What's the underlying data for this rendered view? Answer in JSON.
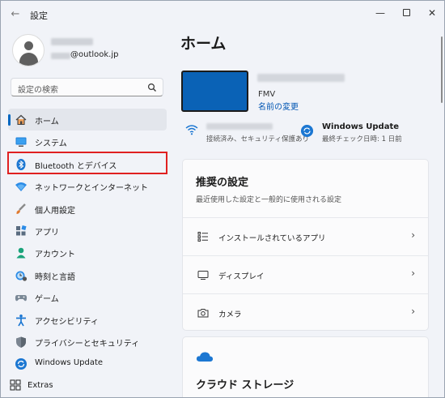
{
  "window": {
    "title": "設定",
    "back_glyph": "←",
    "minimize_glyph": "—",
    "close_glyph": "✕"
  },
  "user": {
    "email_domain": "@outlook.jp"
  },
  "search": {
    "placeholder": "設定の検索"
  },
  "nav": {
    "items": [
      {
        "label": "ホーム",
        "icon": "home-icon",
        "active": true
      },
      {
        "label": "システム",
        "icon": "system-icon"
      },
      {
        "label": "Bluetooth とデバイス",
        "icon": "bluetooth-icon"
      },
      {
        "label": "ネットワークとインターネット",
        "icon": "network-icon"
      },
      {
        "label": "個人用設定",
        "icon": "personalization-icon"
      },
      {
        "label": "アプリ",
        "icon": "apps-icon"
      },
      {
        "label": "アカウント",
        "icon": "accounts-icon"
      },
      {
        "label": "時刻と言語",
        "icon": "time-language-icon"
      },
      {
        "label": "ゲーム",
        "icon": "gaming-icon"
      },
      {
        "label": "アクセシビリティ",
        "icon": "accessibility-icon"
      },
      {
        "label": "プライバシーとセキュリティ",
        "icon": "privacy-icon"
      },
      {
        "label": "Windows Update",
        "icon": "windows-update-icon"
      }
    ],
    "extras_label": "Extras"
  },
  "main": {
    "title": "ホーム",
    "device": {
      "model": "FMV",
      "rename_link": "名前の変更"
    },
    "network": {
      "status": "接続済み、セキュリティ保護あり"
    },
    "windows_update": {
      "title": "Windows Update",
      "last_checked": "最終チェック日時: 1 日前"
    },
    "recommended": {
      "title": "推奨の設定",
      "subtitle": "最近使用した設定と一般的に使用される設定",
      "items": [
        {
          "label": "インストールされているアプリ",
          "icon": "installed-apps-icon"
        },
        {
          "label": "ディスプレイ",
          "icon": "display-icon"
        },
        {
          "label": "カメラ",
          "icon": "camera-icon"
        }
      ],
      "chevron": "›"
    },
    "cloud": {
      "title": "クラウド ストレージ"
    }
  },
  "colors": {
    "accent": "#0067c0",
    "highlight_box": "#e02020",
    "device_screen": "#0a62b6"
  }
}
